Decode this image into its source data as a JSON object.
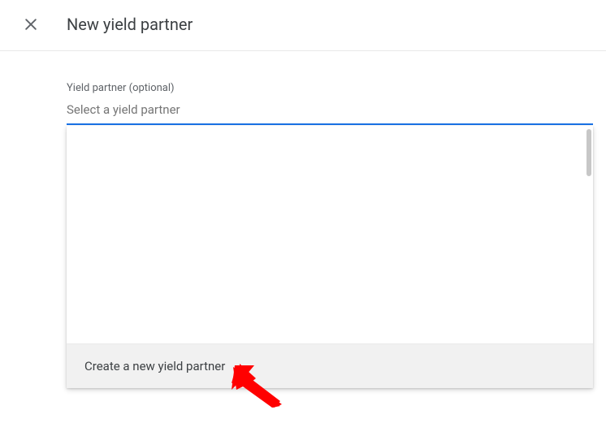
{
  "header": {
    "title": "New yield partner"
  },
  "form": {
    "field_label": "Yield partner (optional)",
    "placeholder": "Select a yield partner"
  },
  "dropdown": {
    "create_label": "Create a new yield partner"
  }
}
